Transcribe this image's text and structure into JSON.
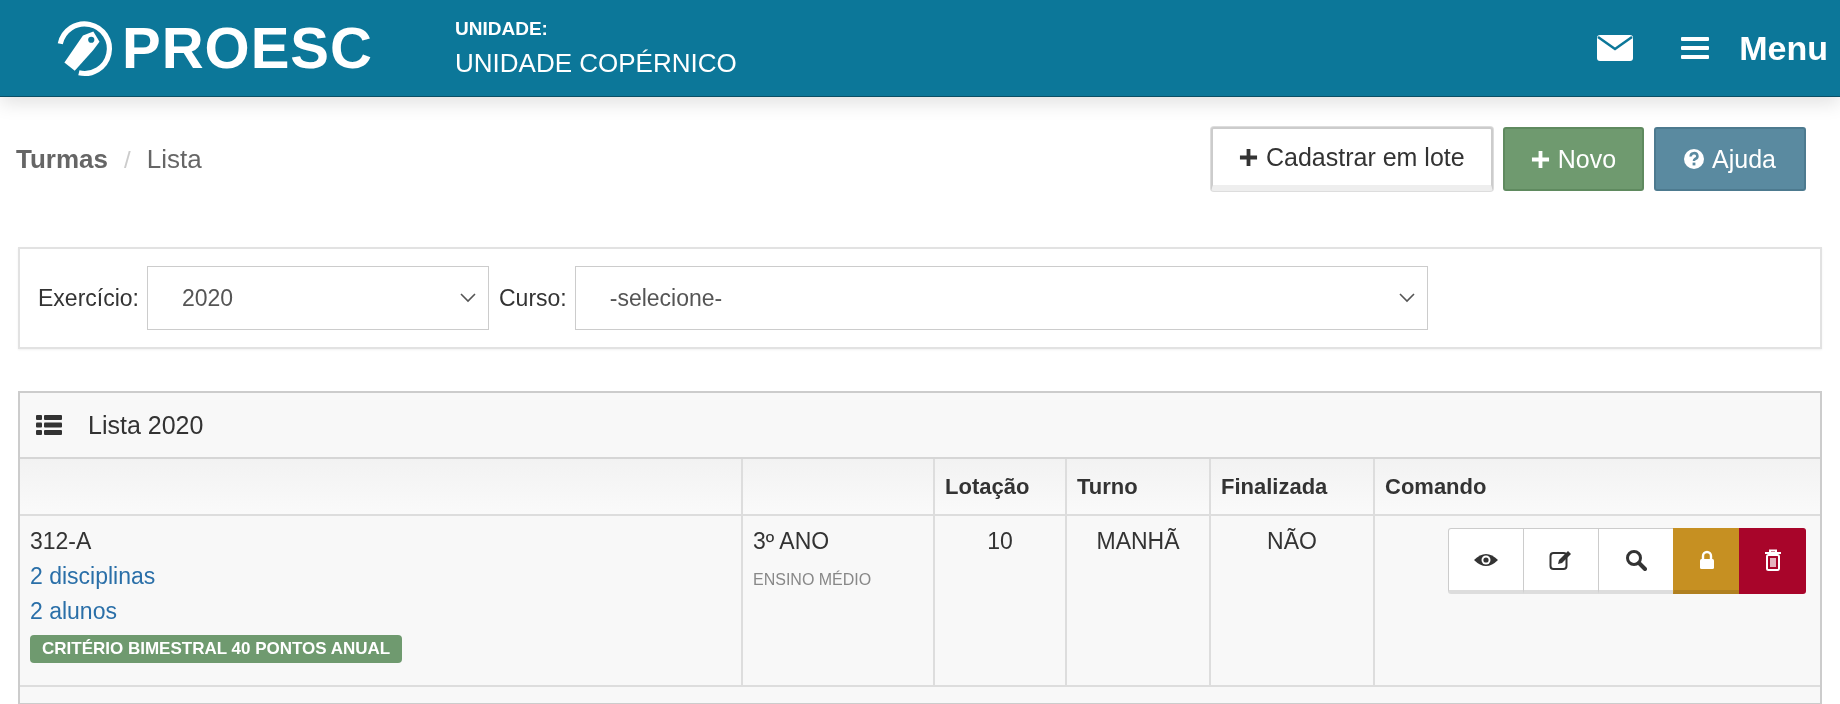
{
  "header": {
    "logo": "PROESC",
    "unit_label": "UNIDADE:",
    "unit_name": "UNIDADE COPÉRNICO",
    "menu_label": "Menu"
  },
  "breadcrumb": [
    "Turmas",
    "Lista"
  ],
  "breadcrumb_separator": "/",
  "actions": [
    {
      "label": "Cadastrar em lote",
      "kind": "default"
    },
    {
      "label": "Novo",
      "kind": "success"
    },
    {
      "label": "Ajuda",
      "kind": "info"
    }
  ],
  "filters": [
    {
      "label": "Exercício:",
      "value": "2020"
    },
    {
      "label": "Curso:",
      "value": "-selecione-"
    }
  ],
  "list": {
    "title": "Lista 2020",
    "columns": [
      {
        "kind": "blank"
      },
      {
        "kind": "blank"
      },
      {
        "kind": "text",
        "label": "Lotação"
      },
      {
        "kind": "text",
        "label": "Turno"
      },
      {
        "kind": "text",
        "label": "Finalizada"
      },
      {
        "kind": "text",
        "label": "Comando"
      }
    ],
    "rows": [
      {
        "name": "312-A",
        "links": [
          "2 disciplinas",
          "2 alunos"
        ],
        "tag": "CRITÉRIO BIMESTRAL 40 PONTOS ANUAL",
        "grade": "3º ANO",
        "grade_level": "ENSINO MÉDIO",
        "capacity": "10",
        "shift": "MANHÃ",
        "finished": "NÃO",
        "commands": [
          {
            "kind": "view"
          },
          {
            "kind": "edit"
          },
          {
            "kind": "search"
          },
          {
            "kind": "lock"
          },
          {
            "kind": "delete"
          }
        ]
      }
    ]
  }
}
